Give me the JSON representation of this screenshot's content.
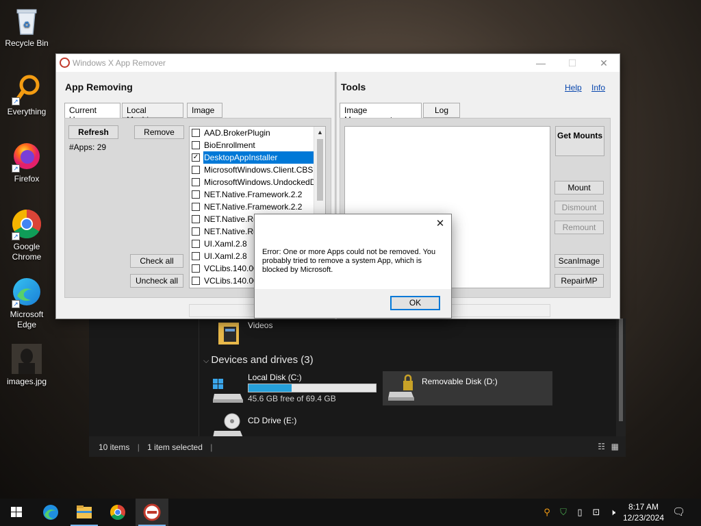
{
  "desktop": {
    "icons": [
      {
        "label": "Recycle Bin",
        "icon": "recycle-bin-icon"
      },
      {
        "label": "Everything",
        "icon": "everything-search-icon"
      },
      {
        "label": "Firefox",
        "icon": "firefox-icon"
      },
      {
        "label": "Google Chrome",
        "icon": "chrome-icon"
      },
      {
        "label": "Microsoft Edge",
        "icon": "edge-icon"
      },
      {
        "label": "images.jpg",
        "icon": "image-file-icon"
      }
    ]
  },
  "explorer": {
    "folder_videos": "Videos",
    "devices_heading": "Devices and drives (3)",
    "drive_c_name": "Local Disk (C:)",
    "drive_c_free": "45.6 GB free of 69.4 GB",
    "drive_c_used_fraction": 0.34,
    "drive_d_name": "Removable Disk (D:)",
    "drive_e_name": "CD Drive (E:)",
    "status_items": "10 items",
    "status_selected": "1 item selected",
    "colors": {
      "usage_bar": "#26a0da"
    }
  },
  "appwin": {
    "title": "Windows X App Remover",
    "controls": {
      "minimize": "—",
      "maximize": "☐",
      "close": "✕"
    },
    "left": {
      "heading": "App Removing",
      "tabs": [
        "Current User",
        "Local Machine",
        "Image"
      ],
      "refresh": "Refresh",
      "remove": "Remove",
      "apps_count": "#Apps: 29",
      "check_all": "Check all",
      "uncheck_all": "Uncheck all",
      "apps": [
        {
          "name": "AAD.BrokerPlugin",
          "checked": false,
          "selected": false
        },
        {
          "name": "BioEnrollment",
          "checked": false,
          "selected": false
        },
        {
          "name": "DesktopAppInstaller",
          "checked": true,
          "selected": true
        },
        {
          "name": "MicrosoftWindows.Client.CBS",
          "checked": false,
          "selected": false
        },
        {
          "name": "MicrosoftWindows.UndockedDevKit",
          "checked": false,
          "selected": false
        },
        {
          "name": "NET.Native.Framework.2.2",
          "checked": false,
          "selected": false
        },
        {
          "name": "NET.Native.Framework.2.2",
          "checked": false,
          "selected": false
        },
        {
          "name": "NET.Native.Runtime.2.2",
          "checked": false,
          "selected": false
        },
        {
          "name": "NET.Native.Runtime.2.2",
          "checked": false,
          "selected": false
        },
        {
          "name": "UI.Xaml.2.8",
          "checked": false,
          "selected": false
        },
        {
          "name": "UI.Xaml.2.8",
          "checked": false,
          "selected": false
        },
        {
          "name": "VCLibs.140.00",
          "checked": false,
          "selected": false
        },
        {
          "name": "VCLibs.140.00",
          "checked": false,
          "selected": false
        }
      ]
    },
    "right": {
      "heading": "Tools",
      "help": "Help",
      "info": "Info",
      "tabs": [
        "Image Management",
        "Log"
      ],
      "get_mounts": "Get Mounts",
      "mount": "Mount",
      "dismount": "Dismount",
      "remount": "Remount",
      "scan_image": "ScanImage",
      "repair_mp": "RepairMP"
    }
  },
  "dialog": {
    "message": "Error: One or more Apps could not be removed. You probably tried to remove a system App, which is blocked by Microsoft.",
    "ok": "OK",
    "close": "✕"
  },
  "taskbar": {
    "time": "8:17 AM",
    "date": "12/23/2024"
  }
}
